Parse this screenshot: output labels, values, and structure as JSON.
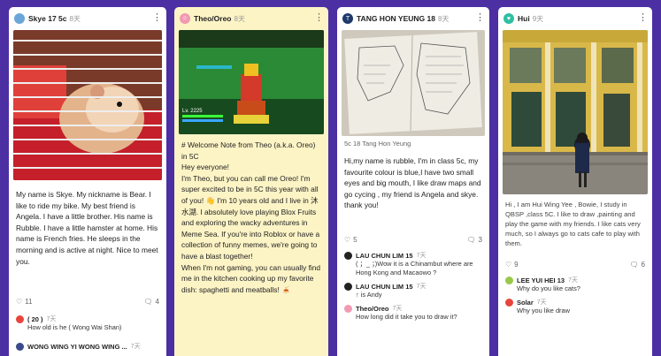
{
  "posts": [
    {
      "author": "Skye 17 5c",
      "time": "8天",
      "body": "My name is Skye. My nickname is Bear. I like to ride my bike. My best friend is Angela. I have a little brother. His name is Rubble. I have a little hamster at home. His name is French fries. He sleeps in the morning and is active at night. Nice to meet you.",
      "likes": "11",
      "comments_count": "4",
      "comments": [
        {
          "author": "( 20 )",
          "time": "7天",
          "text": "How old is he ( Wong Wai Shan)"
        },
        {
          "author": "WONG WING YI WONG WING ...",
          "time": "7天",
          "text": ""
        }
      ]
    },
    {
      "author": "Theo/Oreo",
      "time": "8天",
      "image_caption": "Lv. 2225",
      "body": "# Welcome Note from Theo (a.k.a. Oreo) in 5C\nHey everyone!\nI'm Theo, but you can call me Oreo! I'm super excited to be in 5C this year with all of you! 👋 I'm 10 years old and I live in 沐水湖. I absolutely love playing Blox Fruits and exploring the wacky adventures in Meme Sea. If you're into Roblox or have a collection of funny memes, we're going to have a blast together!\nWhen I'm not gaming, you can usually find me in the kitchen cooking up my favorite dish: spaghetti and meatballs! 🍝"
    },
    {
      "author": "TANG HON YEUNG 18",
      "time": "8天",
      "caption": "5c 18 Tang Hon Yeung",
      "body": "Hi,my name is rubble, I'm in class 5c, my favourite colour is blue,I have two small eyes and big mouth, I like draw maps and go cycing , my friend is Angela and skye. thank you!",
      "likes": "5",
      "comments_count": "3",
      "comments": [
        {
          "author": "LAU CHUN LIM 15",
          "time": "7天",
          "text": "( ；_ ；)Wow it is a Chinambut where are Hong Kong and Macaowo ?"
        },
        {
          "author": "LAU CHUN LIM 15",
          "time": "7天",
          "text": "↑ is Andy"
        },
        {
          "author": "Theo/Oreo",
          "time": "7天",
          "text": "How long did it take you to draw it?"
        }
      ]
    },
    {
      "author": "Hui",
      "time": "9天",
      "body": "Hi , I am Hui Wing Yee , Bowie, I study in QBSP ,class 5C. I like to draw ,painting and play the game with my friends. I like cats very much, so I always go to cats cafe to play with them.",
      "likes": "9",
      "comments_count": "6",
      "comments": [
        {
          "author": "LEE YUI HEI 13",
          "time": "7天",
          "text": "Why do you like cats?"
        },
        {
          "author": "Solar",
          "time": "7天",
          "text": "Why you like draw"
        }
      ]
    }
  ],
  "colors": {
    "board": "#4b2fa3",
    "card_yellow": "#fdf4c6",
    "avatar_pink": "#f19ab2",
    "avatar_navy": "#1d3a6b",
    "avatar_teal": "#2fbfa3"
  }
}
